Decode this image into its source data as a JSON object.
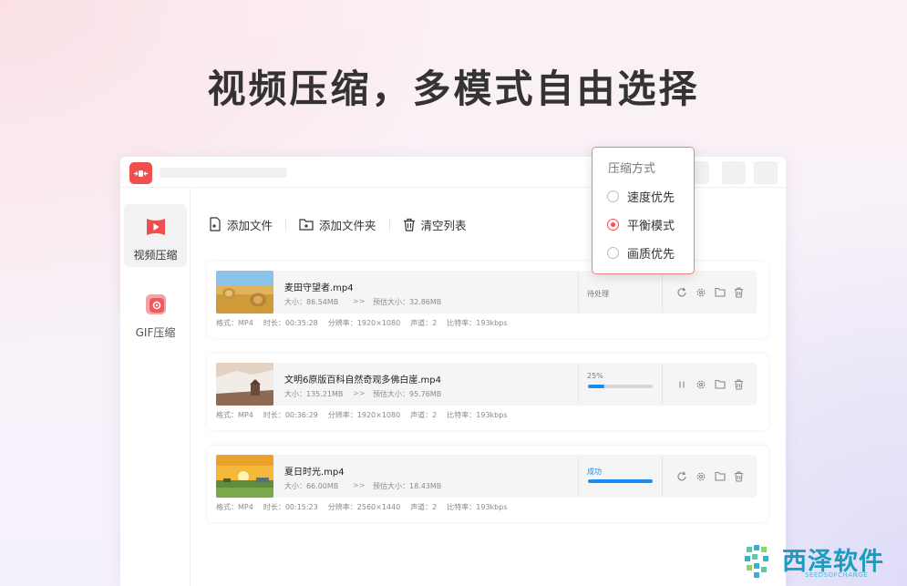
{
  "headline": "视频压缩，多模式自由选择",
  "colors": {
    "accent": "#ef4f4f",
    "progress": "#1a8cf0",
    "brand": "#1b9cc0"
  },
  "sidebar": {
    "items": [
      {
        "label": "视频压缩",
        "icon": "video-play-icon",
        "active": true
      },
      {
        "label": "GIF压缩",
        "icon": "gif-icon",
        "active": false
      }
    ]
  },
  "toolbar": {
    "add_file": "添加文件",
    "add_folder": "添加文件夹",
    "clear_list": "清空列表"
  },
  "compress_mode": {
    "title": "压缩方式",
    "options": [
      "速度优先",
      "平衡模式",
      "画质优先"
    ],
    "selected": "平衡模式"
  },
  "files": [
    {
      "name": "麦田守望者.mp4",
      "size": "大小：86.54MB",
      "arrow": ">>",
      "estimated": "预估大小：32.86MB",
      "status": "待处理",
      "progress": null,
      "meta": [
        "格式：MP4",
        "时长：00:35:28",
        "分辨率：1920×1080",
        "声道：2",
        "比特率：193kbps"
      ]
    },
    {
      "name": "文明6原版百科自然奇观多佛白崖.mp4",
      "size": "大小：135.21MB",
      "arrow": ">>",
      "estimated": "预估大小：95.76MB",
      "status": "25%",
      "progress": 0.25,
      "meta": [
        "格式：MP4",
        "时长：00:36:29",
        "分辨率：1920×1080",
        "声道：2",
        "比特率：193kbps"
      ]
    },
    {
      "name": "夏日时光.mp4",
      "size": "大小：66.00MB",
      "arrow": ">>",
      "estimated": "预估大小：18.43MB",
      "status": "成功",
      "progress": 1.0,
      "meta": [
        "格式：MP4",
        "时长：00:15:23",
        "分辨率：2560×1440",
        "声道：2",
        "比特率：193kbps"
      ]
    }
  ],
  "brand": {
    "name": "西泽软件",
    "sub": "SEEDSOFCHANGE"
  }
}
